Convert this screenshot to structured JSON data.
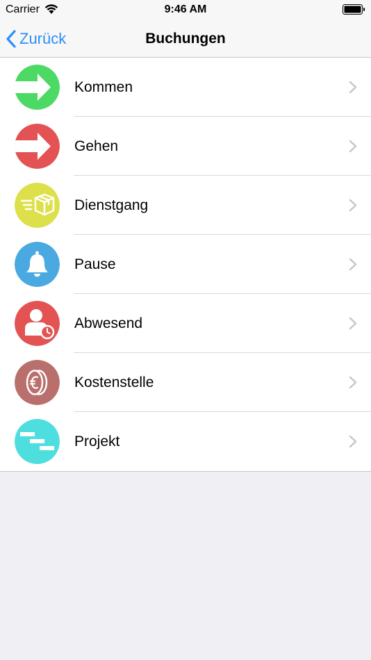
{
  "status_bar": {
    "carrier": "Carrier",
    "time": "9:46 AM"
  },
  "nav": {
    "back_label": "Zurück",
    "title": "Buchungen"
  },
  "colors": {
    "accent": "#2a8ff7",
    "kommen": "#4cd964",
    "gehen": "#e35353",
    "dienstgang": "#dde04a",
    "pause": "#4aa9e0",
    "abwesend": "#e35353",
    "kostenstelle": "#b9706d",
    "projekt": "#4fdede"
  },
  "items": [
    {
      "label": "Kommen",
      "icon": "arrow-right-icon"
    },
    {
      "label": "Gehen",
      "icon": "arrow-right-icon"
    },
    {
      "label": "Dienstgang",
      "icon": "package-icon"
    },
    {
      "label": "Pause",
      "icon": "bell-icon"
    },
    {
      "label": "Abwesend",
      "icon": "person-clock-icon"
    },
    {
      "label": "Kostenstelle",
      "icon": "euro-coin-icon"
    },
    {
      "label": "Projekt",
      "icon": "gantt-icon"
    }
  ]
}
